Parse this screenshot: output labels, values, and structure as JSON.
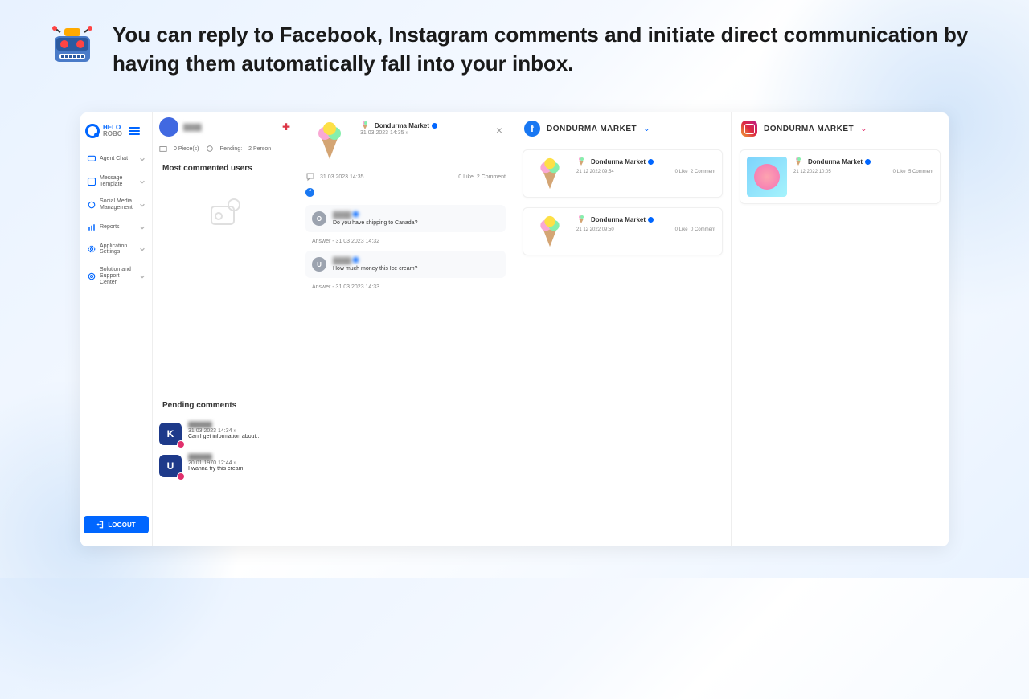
{
  "banner": {
    "text": "You can reply to Facebook, Instagram comments and initiate direct communication by having them automatically fall into your inbox."
  },
  "logo": {
    "line1": "HELO",
    "line2": "ROBO"
  },
  "menu": [
    {
      "label": "Agent Chat"
    },
    {
      "label": "Message Template"
    },
    {
      "label": "Social Media Management"
    },
    {
      "label": "Reports"
    },
    {
      "label": "Application Settings"
    },
    {
      "label": "Solution and Support Center"
    }
  ],
  "logout": "LOGOUT",
  "col1": {
    "pieces": "0 Piece(s)",
    "pending_label": "Pending:",
    "pending_count": "2 Person",
    "most_commented": "Most commented users",
    "pending_title": "Pending comments",
    "pending": [
      {
        "initial": "K",
        "time": "31 03 2023 14:34 »",
        "text": "Can I get information about..."
      },
      {
        "initial": "U",
        "time": "20 01 1970 12:44 »",
        "text": "I wanna try this cream"
      }
    ]
  },
  "col2": {
    "author": "Dondurma Market",
    "post_time": "31 03 2023 14:35 »",
    "engagement_time": "31 03 2023 14:35",
    "likes": "0 Like",
    "comments": "2 Comment",
    "thread": [
      {
        "initial": "O",
        "text": "Do you have shipping to Canada?",
        "answer": "Answer - 31 03 2023 14:32"
      },
      {
        "initial": "U",
        "text": "How much money this Ice cream?",
        "answer": "Answer - 31 03 2023 14:33"
      }
    ]
  },
  "col3": {
    "channel": "DONDURMA MARKET",
    "posts": [
      {
        "author": "Dondurma Market",
        "time": "21 12 2022 09:54",
        "likes": "0 Like",
        "comments": "2 Comment"
      },
      {
        "author": "Dondurma Market",
        "time": "21 12 2022 09:50",
        "likes": "0 Like",
        "comments": "0 Comment"
      }
    ]
  },
  "col4": {
    "channel": "DONDURMA MARKET",
    "posts": [
      {
        "author": "Dondurma Market",
        "time": "21 12 2022 10:05",
        "likes": "0 Like",
        "comments": "5 Comment"
      }
    ]
  }
}
